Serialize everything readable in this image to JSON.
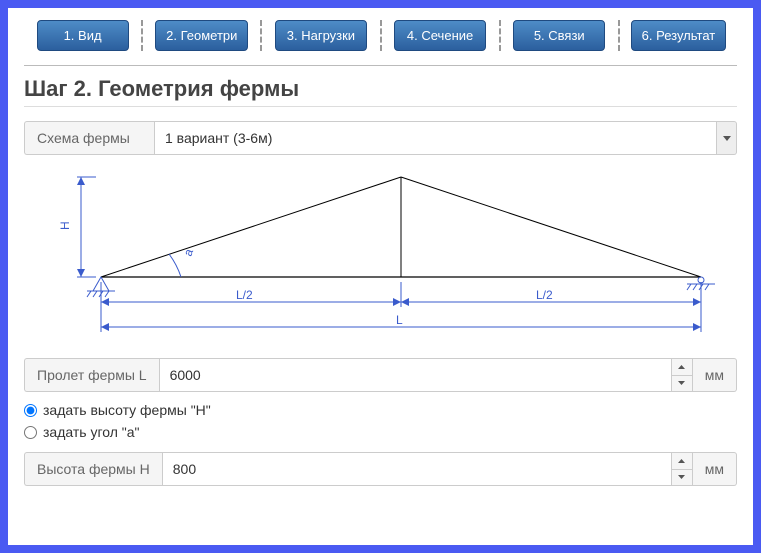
{
  "tabs": [
    {
      "label": "1. Вид"
    },
    {
      "label": "2. Геометри"
    },
    {
      "label": "3. Нагрузки"
    },
    {
      "label": "4. Сечение"
    },
    {
      "label": "5. Связи"
    },
    {
      "label": "6. Результат"
    }
  ],
  "step_title": "Шаг 2. Геометрия фермы",
  "schema": {
    "label": "Схема фермы",
    "selected": "1 вариант (3-6м)"
  },
  "diagram": {
    "h": "H",
    "a": "a",
    "halfspan": "L/2",
    "span": "L"
  },
  "span": {
    "label": "Пролет фермы L",
    "value": "6000",
    "unit": "мм"
  },
  "radio_height": "задать высоту фермы \"H\"",
  "radio_angle": "задать угол \"a\"",
  "height": {
    "label": "Высота фермы H",
    "value": "800",
    "unit": "мм"
  }
}
